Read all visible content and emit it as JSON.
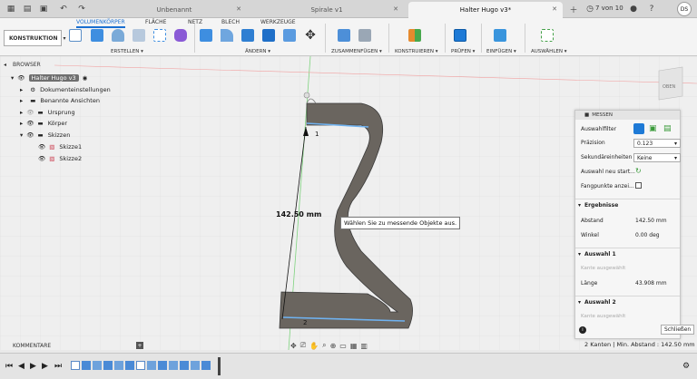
{
  "titlebar": {
    "tabs": [
      {
        "label": "Unbenannt"
      },
      {
        "label": "Spirale v1"
      },
      {
        "label": "Halter Hugo v3*"
      }
    ],
    "page_counter": "7 von 10",
    "user_initials": "DS"
  },
  "ribbon": {
    "workspace": "KONSTRUKTION",
    "tabs": [
      "VOLUMENKÖRPER",
      "FLÄCHE",
      "NETZ",
      "BLECH",
      "WERKZEUGE"
    ],
    "groups": [
      "ERSTELLEN",
      "ÄNDERN",
      "ZUSAMMENFÜGEN",
      "KONSTRUIEREN",
      "PRÜFEN",
      "EINFÜGEN",
      "AUSWÄHLEN"
    ]
  },
  "browser": {
    "title": "BROWSER",
    "root": "Halter Hugo v3",
    "items": [
      {
        "label": "Dokumenteinstellungen"
      },
      {
        "label": "Benannte Ansichten"
      },
      {
        "label": "Ursprung"
      },
      {
        "label": "Körper"
      },
      {
        "label": "Skizzen"
      },
      {
        "label": "Skizze1"
      },
      {
        "label": "Skizze2"
      }
    ]
  },
  "viewcube_label": "OBEN",
  "viewport": {
    "dimension": "142.50 mm",
    "point1": "1",
    "point2": "2",
    "tooltip": "Wählen Sie zu messende Objekte aus."
  },
  "measure": {
    "title": "MESSEN",
    "filter_label": "Auswahlfilter",
    "precision_label": "Präzision",
    "precision_value": "0.123",
    "secondary_label": "Sekundäreinheiten",
    "secondary_value": "Keine",
    "restart_label": "Auswahl neu start...",
    "snap_label": "Fangpunkte anzei...",
    "results_title": "Ergebnisse",
    "distance_label": "Abstand",
    "distance_value": "142.50 mm",
    "angle_label": "Winkel",
    "angle_value": "0.00 deg",
    "sel1_title": "Auswahl 1",
    "sel1_type": "Kante ausgewählt",
    "length_label": "Länge",
    "length_value": "43.908 mm",
    "sel2_title": "Auswahl 2",
    "sel2_type": "Kante ausgewählt",
    "close_label": "Schließen"
  },
  "comments_label": "KOMMENTARE",
  "status_text": "2 Kanten | Min. Abstand : 142.50 mm"
}
